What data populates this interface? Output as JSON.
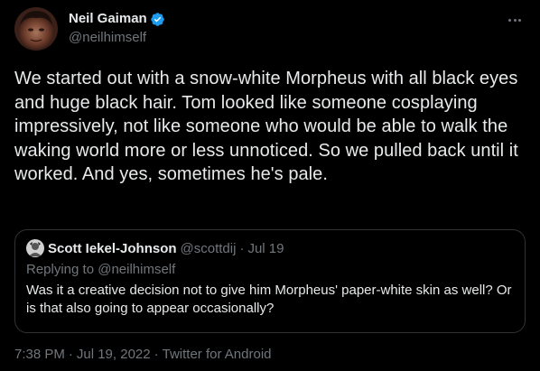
{
  "author": {
    "name": "Neil Gaiman",
    "handle": "@neilhimself",
    "verified": true
  },
  "tweet": {
    "text": "We started out with a snow-white Morpheus with all black eyes and huge black hair. Tom looked like someone cosplaying impressively, not like someone who would be able to walk the waking world more or less unnoticed. So we pulled back until it worked. And yes, sometimes he's pale."
  },
  "quoted": {
    "name": "Scott Iekel-Johnson",
    "handle": "@scottdij",
    "separator": "·",
    "time": "Jul 19",
    "reply_prefix": "Replying to",
    "reply_to": "@neilhimself",
    "text": "Was it a creative decision not to give him Morpheus' paper-white skin as well? Or is that also going to appear occasionally?"
  },
  "meta": {
    "time": "7:38 PM",
    "separator": "·",
    "date": "Jul 19, 2022",
    "source": "Twitter for Android"
  },
  "colors": {
    "background": "#000000",
    "text": "#e7e9ea",
    "secondary": "#71767b",
    "border": "#2f3336",
    "verified": "#1d9bf0"
  },
  "icons": {
    "more": "more-horizontal-icon",
    "verified": "verified-badge-icon"
  }
}
